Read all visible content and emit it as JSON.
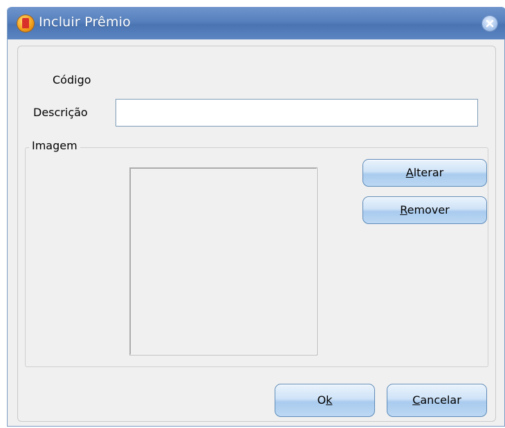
{
  "window": {
    "title": "Incluir Prêmio",
    "app_icon": "app-logo-icon",
    "close_icon": "close-icon"
  },
  "form": {
    "codigo_label": "Código",
    "codigo_value": "",
    "descricao_label": "Descrição",
    "descricao_value": "",
    "imagem_group_label": "Imagem"
  },
  "buttons": {
    "alterar": {
      "mnemonic": "A",
      "rest": "lterar"
    },
    "remover": {
      "mnemonic": "R",
      "rest": "emover"
    },
    "ok": {
      "pre": "O",
      "mnemonic": "k",
      "rest": ""
    },
    "cancelar": {
      "mnemonic": "C",
      "rest": "ancelar"
    }
  },
  "colors": {
    "titlebar": "#5680bd",
    "button_face": "#cfe3f7",
    "button_border": "#5d8ab8",
    "dialog_background": "#f0f0f0"
  }
}
